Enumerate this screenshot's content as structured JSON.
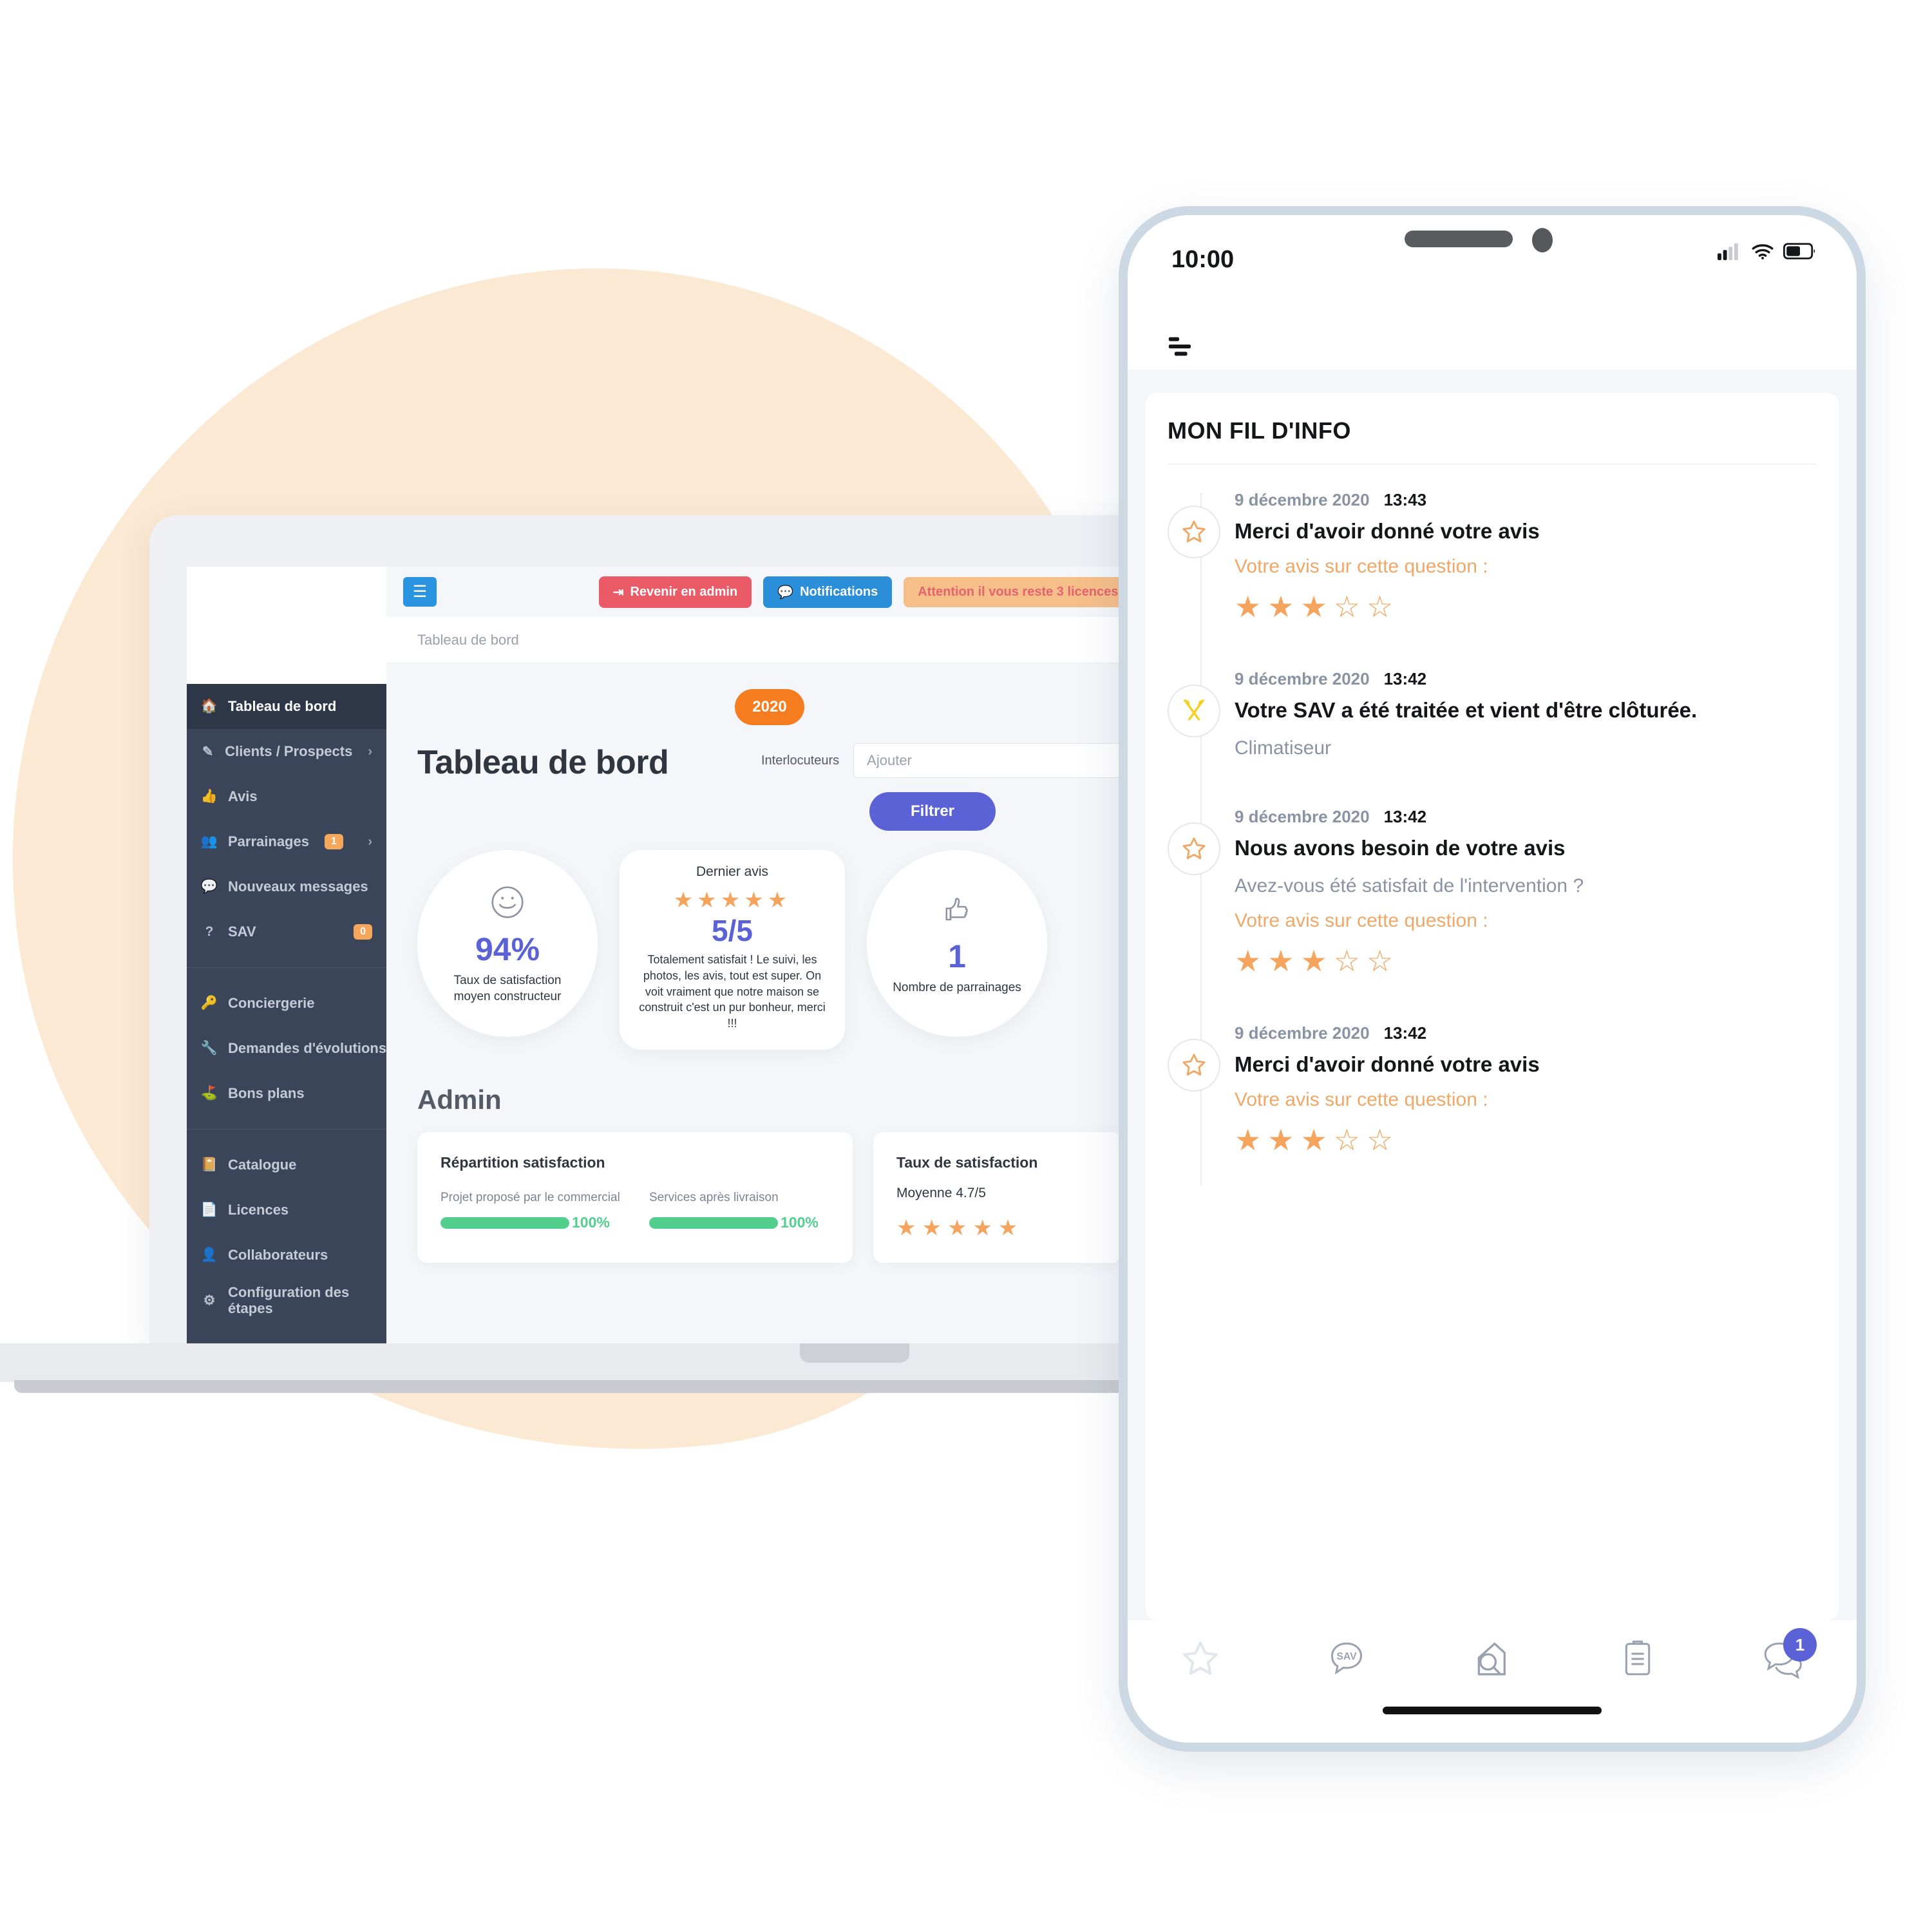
{
  "colors": {
    "peach": "#fce9d4",
    "sidebar_bg": "#3b4559",
    "sidebar_active": "#2d3748",
    "accent_orange": "#f57d20",
    "accent_indigo": "#5b62d6",
    "star_orange": "#f5a45e",
    "green": "#52cf8c",
    "red": "#ea5a67",
    "blue": "#2a8fd8",
    "phone_frame": "#ccd8e3"
  },
  "desktop": {
    "topbar": {
      "menu_icon": "hamburger-icon",
      "admin_button": {
        "label": "Revenir en admin",
        "icon": "sign-out-icon"
      },
      "notifications_button": {
        "label": "Notifications",
        "icon": "comments-icon"
      },
      "license_warning": "Attention il vous reste 3 licences."
    },
    "breadcrumb": "Tableau de bord",
    "year_badge": "2020",
    "page_title": "Tableau de bord",
    "filter": {
      "label": "Interlocuteurs",
      "placeholder": "Ajouter",
      "value": "",
      "button_label": "Filtrer"
    },
    "sidebar": {
      "items": [
        {
          "label": "Tableau de bord",
          "icon": "home-icon",
          "active": true,
          "badge": null,
          "chevron": false
        },
        {
          "label": "Clients / Prospects",
          "icon": "edit-icon",
          "active": false,
          "badge": null,
          "chevron": true
        },
        {
          "label": "Avis",
          "icon": "thumbs-up-icon",
          "active": false,
          "badge": null,
          "chevron": false
        },
        {
          "label": "Parrainages",
          "icon": "users-icon",
          "active": false,
          "badge": "1",
          "chevron": true
        },
        {
          "label": "Nouveaux messages",
          "icon": "comment-icon",
          "active": false,
          "badge": null,
          "chevron": false
        },
        {
          "label": "SAV",
          "icon": "question-icon",
          "active": false,
          "badge": "0",
          "badge_right": true,
          "chevron": false
        }
      ],
      "items_group2": [
        {
          "label": "Conciergerie",
          "icon": "key-icon"
        },
        {
          "label": "Demandes d'évolutions",
          "icon": "wrench-icon"
        },
        {
          "label": "Bons plans",
          "icon": "parking-icon"
        }
      ],
      "items_group3": [
        {
          "label": "Catalogue",
          "icon": "book-icon"
        },
        {
          "label": "Licences",
          "icon": "file-icon"
        },
        {
          "label": "Collaborateurs",
          "icon": "user-plus-icon"
        },
        {
          "label": "Configuration des étapes",
          "icon": "cogs-icon"
        }
      ]
    },
    "cards": {
      "satisfaction": {
        "icon": "smiley-face-icon",
        "value": "94%",
        "caption": "Taux de satisfaction moyen constructeur"
      },
      "last_review": {
        "title": "Dernier avis",
        "stars_filled": 5,
        "stars_total": 5,
        "score": "5/5",
        "text": "Totalement satisfait ! Le suivi, les photos, les avis, tout est super. On voit vraiment que notre maison se construit c'est un pur bonheur, merci !!!"
      },
      "sponsorships": {
        "icon": "thumbs-up-outline-icon",
        "value": "1",
        "caption": "Nombre de parrainages"
      }
    },
    "admin": {
      "section_title": "Admin",
      "repartition": {
        "title": "Répartition satisfaction",
        "bars": [
          {
            "label": "Projet proposé par le commercial",
            "percent": 100,
            "percent_label": "100%"
          },
          {
            "label": "Services après livraison",
            "percent": 100,
            "percent_label": "100%"
          }
        ]
      },
      "taux": {
        "title": "Taux de satisfaction",
        "average": "Moyenne 4.7/5",
        "stars_filled": 5,
        "stars_total": 5
      }
    }
  },
  "phone": {
    "status": {
      "time": "10:00",
      "signal_icon": "cellular-signal-icon",
      "wifi_icon": "wifi-icon",
      "battery_icon": "battery-icon"
    },
    "menu_icon": "hamburger-icon",
    "feed_title": "MON FIL D'INFO",
    "feed": [
      {
        "icon": "star-outline-icon",
        "icon_color": "#f0a868",
        "date": "9 décembre 2020",
        "time": "13:43",
        "headline": "Merci d'avoir donné votre avis",
        "question": "Votre avis sur cette question :",
        "body": "",
        "stars_filled": 3,
        "stars_total": 5
      },
      {
        "icon": "crossed-tools-icon",
        "icon_color": "#f5cf2a",
        "date": "9 décembre 2020",
        "time": "13:42",
        "headline": "Votre SAV a été traitée et vient d'être clôturée.",
        "question": "",
        "body": "Climatiseur",
        "stars_filled": 0,
        "stars_total": 0
      },
      {
        "icon": "star-outline-icon",
        "icon_color": "#f0a868",
        "date": "9 décembre 2020",
        "time": "13:42",
        "headline": "Nous avons besoin de votre avis",
        "question": "Votre avis sur cette question :",
        "body": "Avez-vous été satisfait de l'intervention ?",
        "stars_filled": 3,
        "stars_total": 5
      },
      {
        "icon": "star-outline-icon",
        "icon_color": "#f0a868",
        "date": "9 décembre 2020",
        "time": "13:42",
        "headline": "Merci d'avoir donné votre avis",
        "question": "Votre avis sur cette question :",
        "body": "",
        "stars_filled": 3,
        "stars_total": 5
      }
    ],
    "tabs": [
      {
        "name": "star-tab",
        "icon": "star-outline-icon",
        "badge": null
      },
      {
        "name": "sav-tab",
        "icon": "sav-bubble-icon",
        "label": "SAV",
        "badge": null
      },
      {
        "name": "house-tab",
        "icon": "house-search-icon",
        "badge": null
      },
      {
        "name": "clipboard-tab",
        "icon": "clipboard-icon",
        "badge": null
      },
      {
        "name": "messages-tab",
        "icon": "chat-bubbles-icon",
        "badge": "1"
      }
    ]
  }
}
